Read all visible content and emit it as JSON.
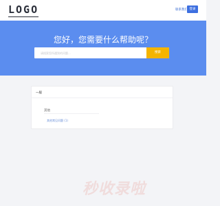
{
  "header": {
    "logo": "LOGO",
    "contact_link": "联系我们",
    "login_button": "登录"
  },
  "hero": {
    "title": "您好，您需要什么帮助呢？",
    "search_placeholder": "请搜索您所遇到的问题...",
    "search_button": "搜索"
  },
  "card": {
    "title": "一般",
    "item_label": "其他",
    "item_link": "其他常见问题 (1)"
  },
  "watermark": "秒收录啦"
}
